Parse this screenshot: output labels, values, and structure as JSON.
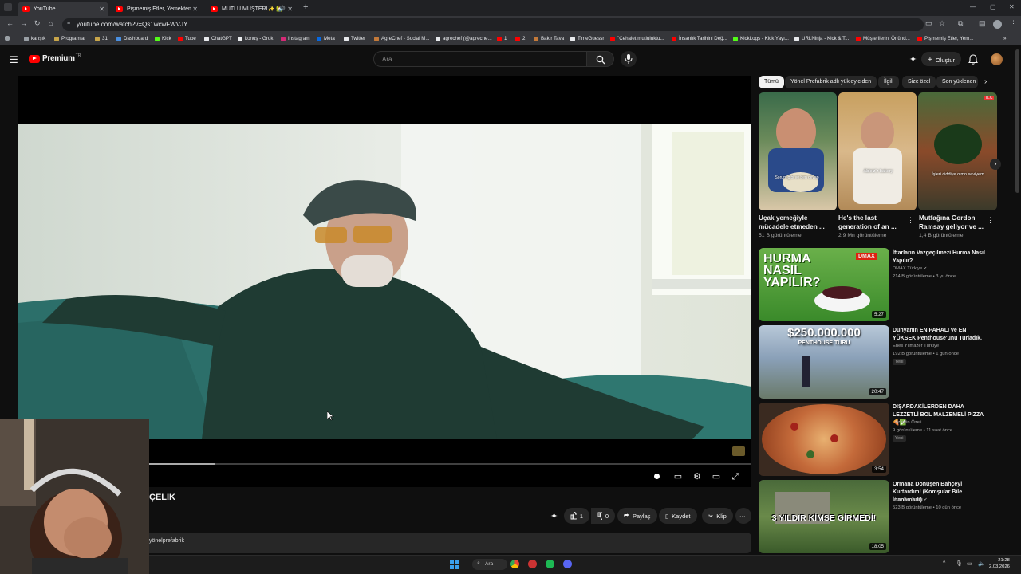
{
  "browser": {
    "tabs": [
      {
        "title": "YouTube",
        "active": true
      },
      {
        "title": "Pişmemiş Etler, Yemekten Çıkan",
        "active": false
      },
      {
        "title": "MUTLU MÜŞTERİ✨ 🏡 Hi",
        "active": false
      }
    ],
    "new_tab": "+",
    "url": "youtube.com/watch?v=Qs1wcwFWVJY",
    "bookmarks": [
      "karışık",
      "Programlar",
      "31",
      "Dashboard",
      "Kick",
      "Tube",
      "ChatGPT",
      "konuş - Grok",
      "Instagram",
      "Meta",
      "Twitter",
      "AgreChef - Social M...",
      "agrechef (@agreche...",
      "1",
      "2",
      "Bakır Tava",
      "TimeGuessr",
      "\"Cehalet mutluluktu...",
      "İnsanlık Tarihini Değ...",
      "KickLogs - Kick Yayı...",
      "URLNinja - Kick & T...",
      "Müşterilerini Önünd...",
      "Pişmemiş Etler, Yem..."
    ]
  },
  "youtube": {
    "logo": "Premium",
    "logo_region": "TR",
    "search_placeholder": "Ara",
    "create_label": "Oluştur",
    "brand_color": "#ff0000"
  },
  "video": {
    "title_partial": "ÇELIK",
    "channel_partial": "yönelprefabrik",
    "progress": 0.11,
    "actions": {
      "like_count": "1",
      "dislike_count": "0",
      "share": "Paylaş",
      "save": "Kaydet",
      "clip": "Klip"
    }
  },
  "chips": [
    "Tümü",
    "Yönel Prefabrik adlı yükleyiciden",
    "İlgili",
    "Size özel",
    "Son yüklenen"
  ],
  "shorts": [
    {
      "title": "Uçak yemeğiyle mücadele etmeden ...",
      "views": "51 B görüntüleme",
      "overlay": "Sorum gibi ve ben cevap"
    },
    {
      "title": "He's the last generation of an ...",
      "views": "2,9 Mn görüntüleme",
      "overlay": "Ableiz'z bakery"
    },
    {
      "title": "Mutfağına Gordon Ramsay geliyor ve ...",
      "views": "1,4 B görüntüleme",
      "overlay": "İşleri ciddiye olmo seviyem"
    }
  ],
  "recommendations": [
    {
      "title": "İftarların Vazgeçilmezi Hurma Nasıl Yapılır?",
      "channel": "DMAX Türkiye",
      "meta": "214 B görüntüleme • 3 yıl önce",
      "duration": "5:27",
      "badge": "",
      "thumb_text": "HURMA NASIL YAPILIR?",
      "thumb_logo": "DMAX"
    },
    {
      "title": "Dünyanın EN PAHALI ve EN YÜKSEK Penthouse'unu Turladık.",
      "channel": "Enes Yılmazer Türkiye",
      "meta": "192 B görüntüleme • 1 gün önce",
      "duration": "20:47",
      "badge": "Yeni",
      "thumb_text": "$250.000.000",
      "thumb_sub": "PENTHOUSE TURU"
    },
    {
      "title": "DIŞARDAKİLERDEN DAHA LEZZETLİ BOL MALZEMELİ PİZZA 🍕✅",
      "channel": "Lezzetin Özeli",
      "meta": "9 görüntüleme • 11 saat önce",
      "duration": "3:54",
      "badge": "Yeni"
    },
    {
      "title": "Ormana Dönüşen Bahçeyi Kurtardım! (Komşular Bile İnanamadı)",
      "channel": "Ursu Benlioğlu",
      "meta": "523 B görüntüleme • 10 gün önce",
      "duration": "18:05",
      "badge": "",
      "thumb_text": "3 YILDIR KİMSE GİRMEDİ!"
    }
  ],
  "taskbar": {
    "search": "Ara",
    "time": "21:28",
    "date": "2.03.2026"
  }
}
